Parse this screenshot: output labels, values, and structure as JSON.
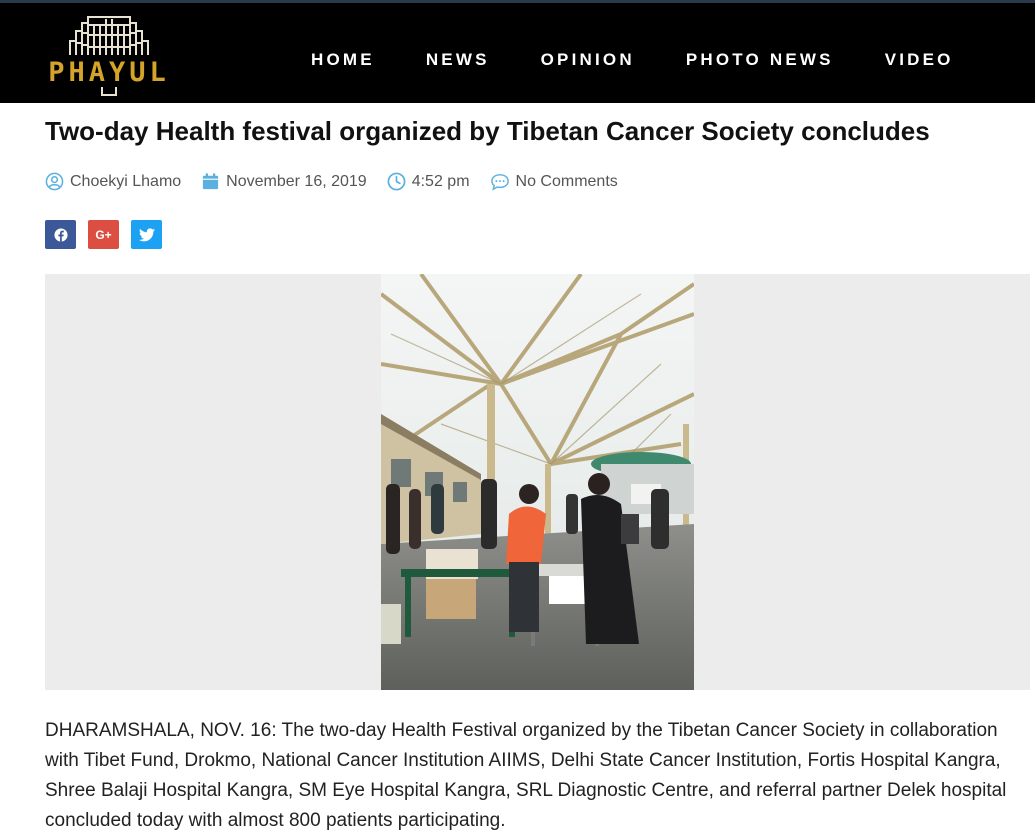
{
  "site": {
    "logo_text": "PHAYUL"
  },
  "nav": {
    "items": [
      {
        "label": "HOME"
      },
      {
        "label": "NEWS"
      },
      {
        "label": "OPINION"
      },
      {
        "label": "PHOTO NEWS"
      },
      {
        "label": "VIDEO"
      }
    ]
  },
  "article": {
    "title": "Two-day Health festival organized by Tibetan Cancer Society concludes",
    "author": "Choekyi Lhamo",
    "date": "November 16, 2019",
    "time": "4:52 pm",
    "comments": "No Comments",
    "body": "DHARAMSHALA, NOV. 16: The two-day Health Festival organized by the Tibetan Cancer Society in collaboration with Tibet Fund, Drokmo, National Cancer Institution AIIMS, Delhi State Cancer Institution, Fortis Hospital Kangra, Shree Balaji Hospital Kangra, SM Eye Hospital Kangra, SRL Diagnostic Centre, and referral partner Delek hospital concluded today with almost 800 patients participating."
  },
  "share": {
    "gplus_label": "G+",
    "icons": [
      "facebook-icon",
      "google-plus-icon",
      "twitter-icon"
    ]
  },
  "colors": {
    "header_bg": "#000000",
    "logo_gold": "#d4a32a",
    "meta_icon": "#5bb0e0",
    "facebook": "#3b5998",
    "google_plus": "#dc4e41",
    "twitter": "#1da1f2",
    "figure_bg": "#ececec"
  }
}
